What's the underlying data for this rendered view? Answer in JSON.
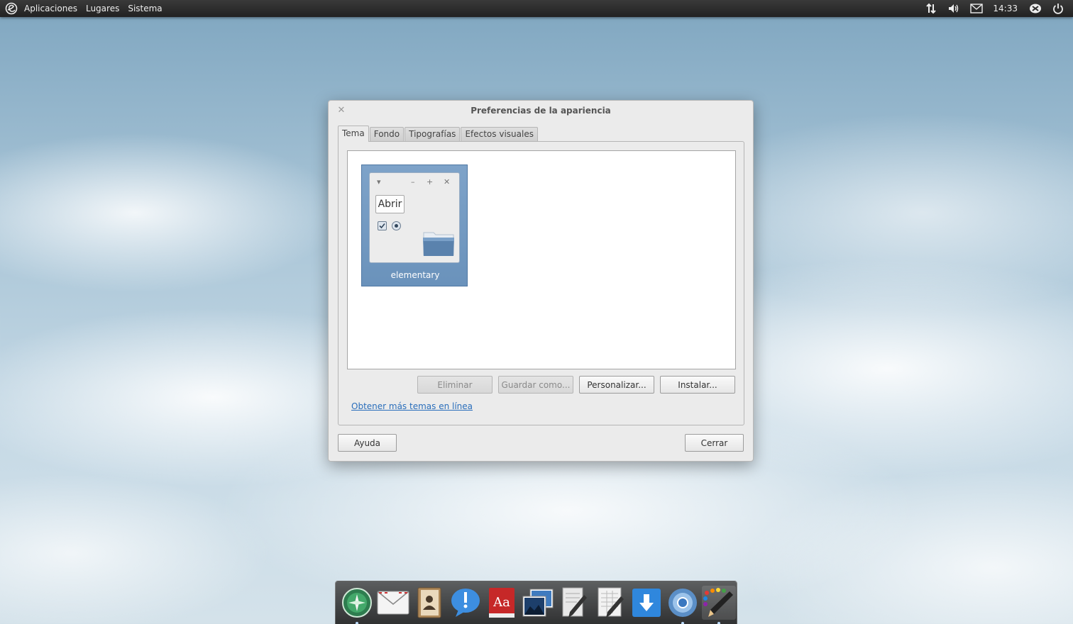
{
  "top_panel": {
    "logo_icon": "elementary-logo-icon",
    "menus": [
      "Aplicaciones",
      "Lugares",
      "Sistema"
    ],
    "indicators": [
      "network-icon",
      "volume-icon",
      "mail-icon"
    ],
    "clock": "14:33",
    "extra_indicators": [
      "user-icon",
      "power-icon"
    ]
  },
  "dialog": {
    "title": "Preferencias de la apariencia",
    "tabs": [
      "Tema",
      "Fondo",
      "Tipografías",
      "Efectos visuales"
    ],
    "active_tab": "Tema",
    "themes": [
      {
        "name": "elementary",
        "preview_button": "Abrir",
        "selected": true
      }
    ],
    "buttons": {
      "eliminar": "Eliminar",
      "guardar": "Guardar como...",
      "personalizar": "Personalizar...",
      "instalar": "Instalar..."
    },
    "link": "Obtener más temas en línea",
    "footer": {
      "help": "Ayuda",
      "close": "Cerrar"
    }
  },
  "dock": {
    "items": [
      {
        "name": "web-browser-icon",
        "active": true
      },
      {
        "name": "mail-icon",
        "active": false
      },
      {
        "name": "contacts-icon",
        "active": false
      },
      {
        "name": "messaging-icon",
        "active": false
      },
      {
        "name": "dictionary-icon",
        "active": false
      },
      {
        "name": "photos-icon",
        "active": false
      },
      {
        "name": "text-editor-icon",
        "active": false
      },
      {
        "name": "office-writer-icon",
        "active": false
      },
      {
        "name": "downloads-icon",
        "active": false
      },
      {
        "name": "chromium-icon",
        "active": true
      },
      {
        "name": "appearance-icon",
        "active": true
      }
    ]
  },
  "colors": {
    "accent": "#2a6ebb",
    "selection": "#7ea3c9",
    "panel": "#2a2a2a"
  }
}
